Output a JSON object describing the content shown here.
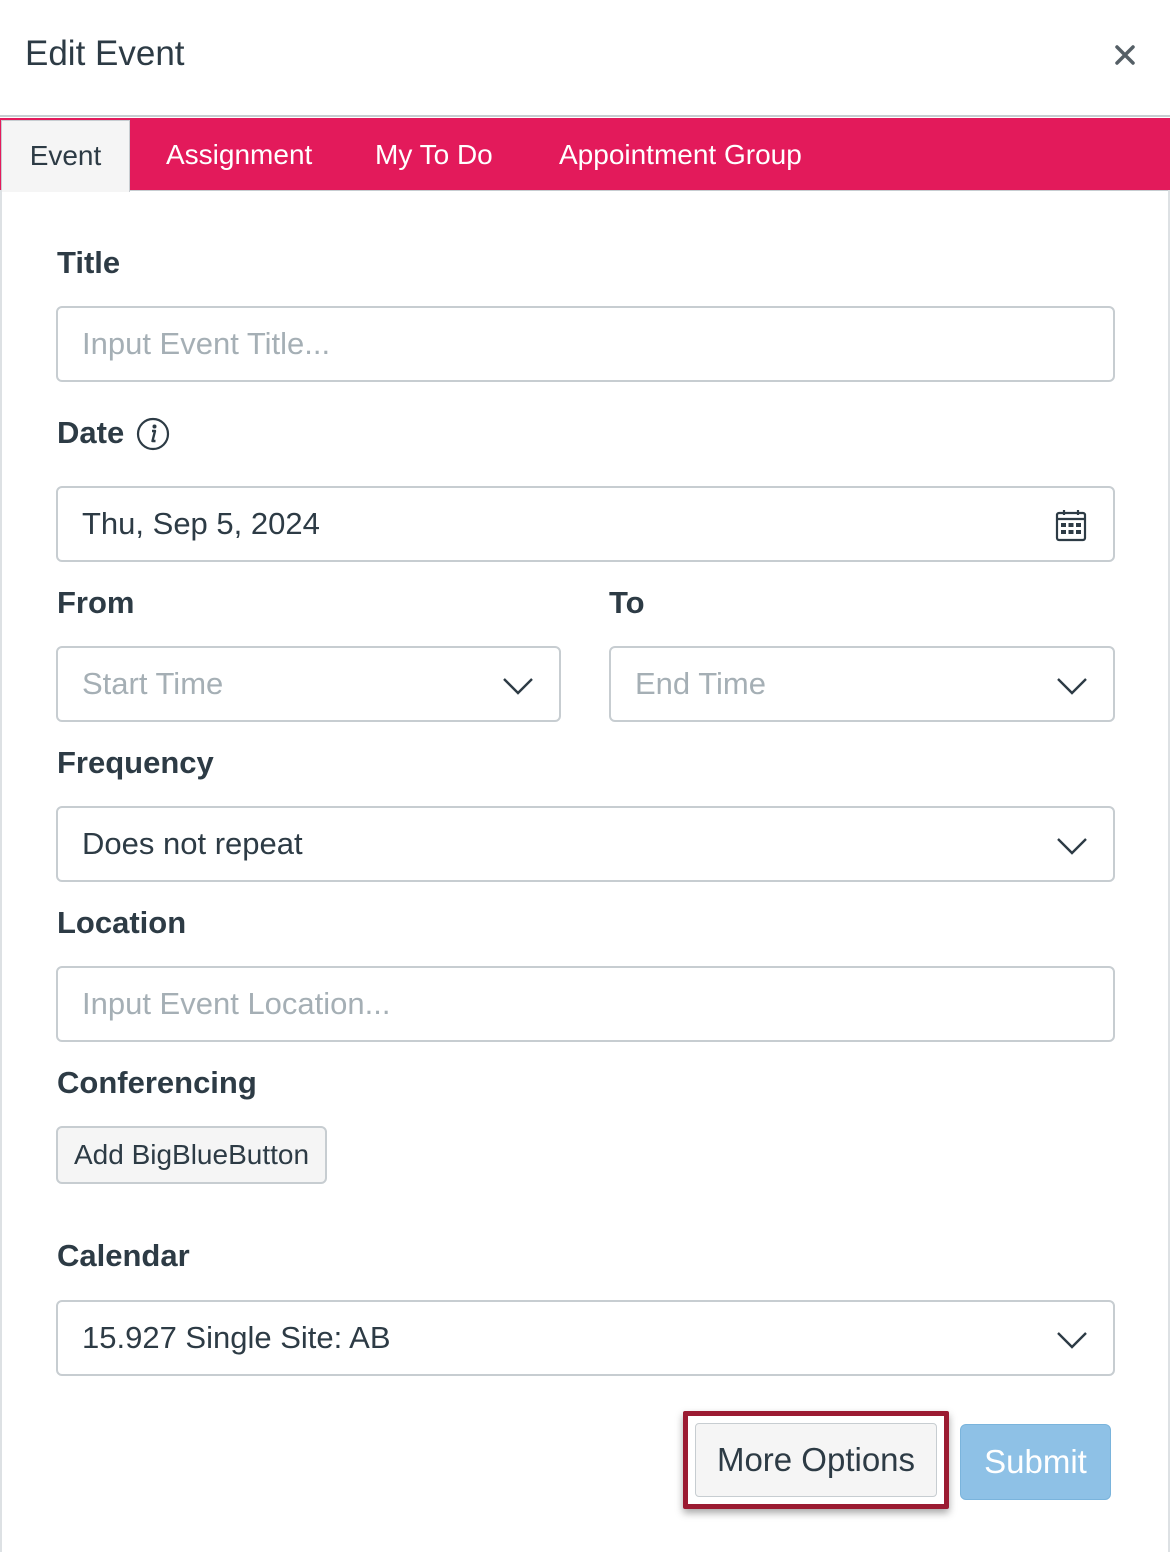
{
  "header": {
    "title": "Edit Event",
    "close_icon": "close-icon"
  },
  "tabs": [
    {
      "label": "Event",
      "active": true
    },
    {
      "label": "Assignment",
      "active": false
    },
    {
      "label": "My To Do",
      "active": false
    },
    {
      "label": "Appointment Group",
      "active": false
    }
  ],
  "form": {
    "title": {
      "label": "Title",
      "placeholder": "Input Event Title...",
      "value": ""
    },
    "date": {
      "label": "Date",
      "value": "Thu, Sep 5, 2024",
      "info_icon": "info-icon",
      "calendar_icon": "calendar-icon"
    },
    "from": {
      "label": "From",
      "placeholder": "Start Time"
    },
    "to": {
      "label": "To",
      "placeholder": "End Time"
    },
    "frequency": {
      "label": "Frequency",
      "value": "Does not repeat"
    },
    "location": {
      "label": "Location",
      "placeholder": "Input Event Location...",
      "value": ""
    },
    "conferencing": {
      "label": "Conferencing",
      "button": "Add BigBlueButton"
    },
    "calendar": {
      "label": "Calendar",
      "value": "15.927 Single Site: AB"
    }
  },
  "footer": {
    "more_options": "More Options",
    "submit": "Submit"
  },
  "colors": {
    "tab_bar": "#e31a5b",
    "highlight": "#9b1b32",
    "submit_disabled": "#8ec1e6",
    "text": "#2d3b45",
    "placeholder": "#a5afb5"
  }
}
